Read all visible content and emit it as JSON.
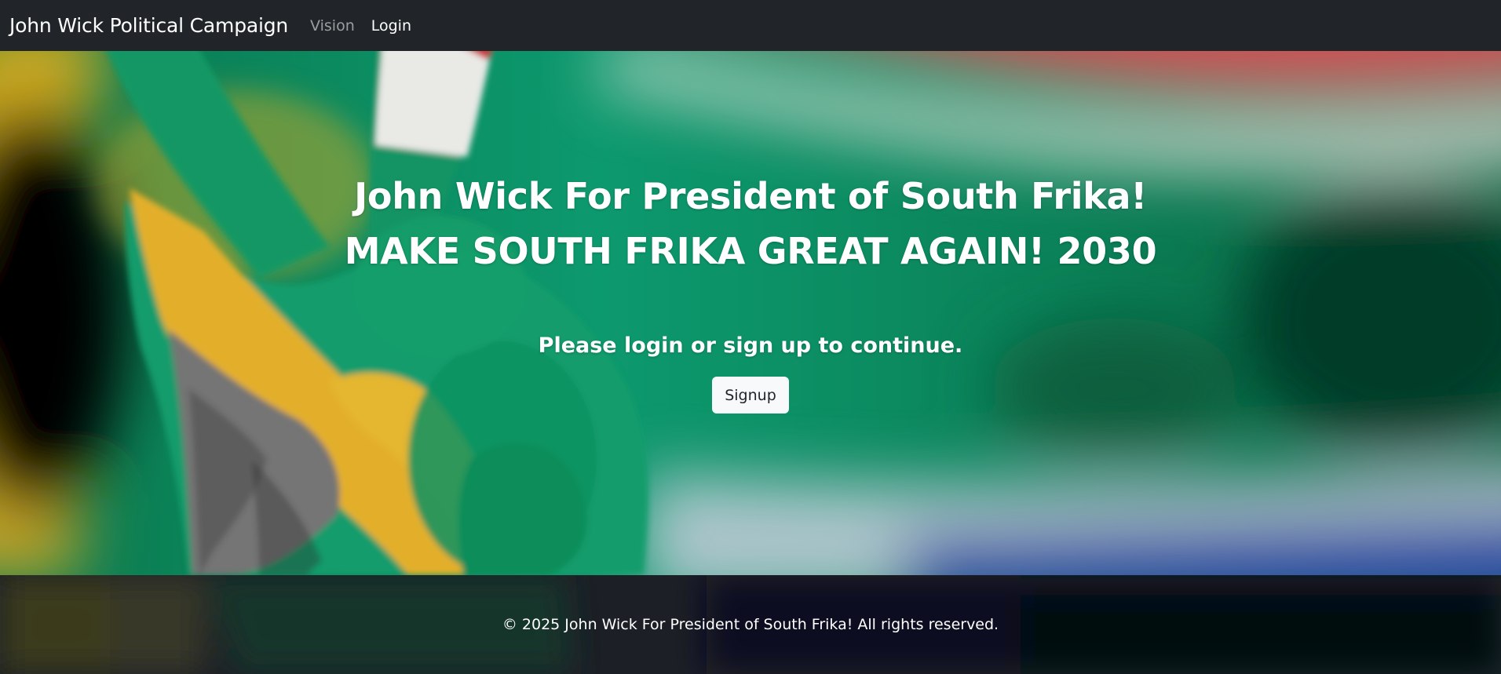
{
  "navbar": {
    "brand": "John Wick Political Campaign",
    "links": [
      {
        "label": "Vision",
        "state": "inactive"
      },
      {
        "label": "Login",
        "state": "active"
      }
    ]
  },
  "hero": {
    "title": "John Wick For President of South Frika!",
    "subtitle": "MAKE SOUTH FRIKA GREAT AGAIN! 2030",
    "prompt": "Please login or sign up to continue.",
    "signup_label": "Signup"
  },
  "footer": {
    "copyright": "© 2025 John Wick For President of South Frika! All rights reserved."
  },
  "colors": {
    "navbar_bg": "#212529",
    "flag_green": "#0a9a6a",
    "flag_red": "#d9323a",
    "flag_yellow": "#f2bf2e",
    "flag_blue": "#2a4fa8",
    "footer_dark": "#0b0e1a"
  }
}
